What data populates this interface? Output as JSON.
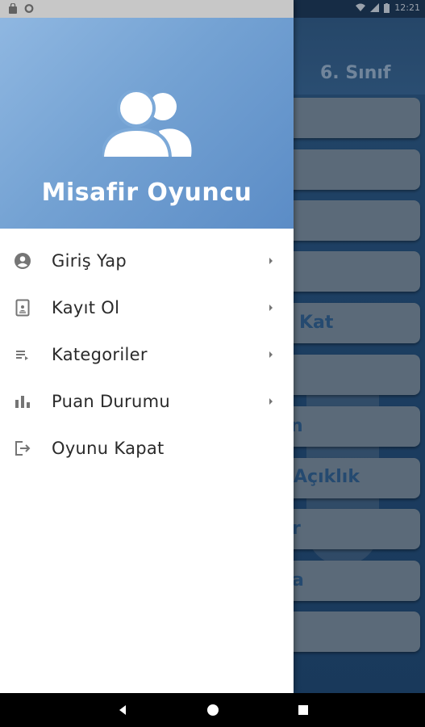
{
  "status_bar": {
    "time": "12:21"
  },
  "drawer": {
    "header": {
      "player_name": "Misafir Oyuncu",
      "avatar_icon": "users-group-icon"
    },
    "menu": [
      {
        "label": "Giriş Yap",
        "icon": "account-circle-icon",
        "has_chevron": true
      },
      {
        "label": "Kayıt Ol",
        "icon": "register-document-icon",
        "has_chevron": true
      },
      {
        "label": "Kategoriler",
        "icon": "category-list-icon",
        "has_chevron": true
      },
      {
        "label": "Puan Durumu",
        "icon": "bar-chart-icon",
        "has_chevron": true
      },
      {
        "label": "Oyunu Kapat",
        "icon": "exit-icon",
        "has_chevron": false
      }
    ]
  },
  "background_app": {
    "grade_title": "6. Sınıf",
    "visible_tile_labels": [
      "Kat",
      "n",
      "Açıklık",
      "r",
      "a"
    ]
  },
  "navigation_bar": {
    "back_icon": "back-triangle-icon",
    "home_icon": "home-circle-icon",
    "recents_icon": "recents-square-icon"
  },
  "colors": {
    "header_gradient_start": "#8fb7e1",
    "header_gradient_end": "#5b8cc6",
    "menu_text": "#2a2a2a",
    "icon_grey": "#757575"
  }
}
